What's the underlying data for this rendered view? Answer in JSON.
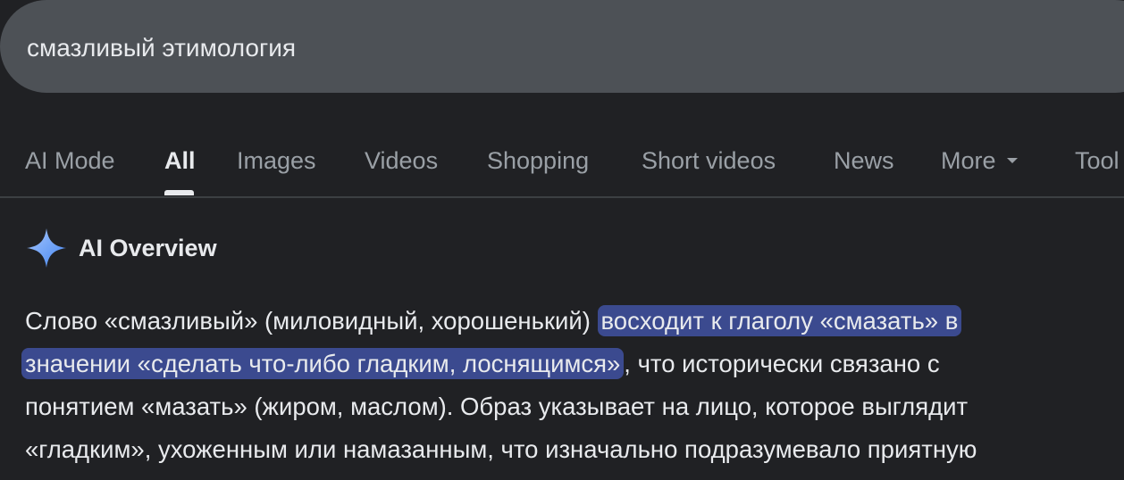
{
  "search": {
    "query": "смазливый этимология"
  },
  "tabs": [
    {
      "label": "AI Mode"
    },
    {
      "label": "All"
    },
    {
      "label": "Images"
    },
    {
      "label": "Videos"
    },
    {
      "label": "Shopping"
    },
    {
      "label": "Short videos"
    },
    {
      "label": "News"
    },
    {
      "label": "More"
    },
    {
      "label": "Tool"
    }
  ],
  "ai_overview": {
    "title": "AI Overview",
    "line1_plain": "Слово «смазливый» (миловидный, хорошенький) ",
    "line1_highlight": "восходит к глаголу «смазать» в",
    "line2_highlight": "значении «сделать что-либо гладким, лоснящимся»",
    "line2_plain": ", что исторически связано с",
    "line3": "понятием «мазать» (жиром, маслом). Образ указывает на лицо, которое выглядит",
    "line4": "«гладким», ухоженным или намазанным, что изначально подразумевало приятную"
  },
  "colors": {
    "background": "#202124",
    "search_bar": "#4d5156",
    "highlight": "#3b4a8f",
    "sparkle": "#8ab4f8"
  }
}
